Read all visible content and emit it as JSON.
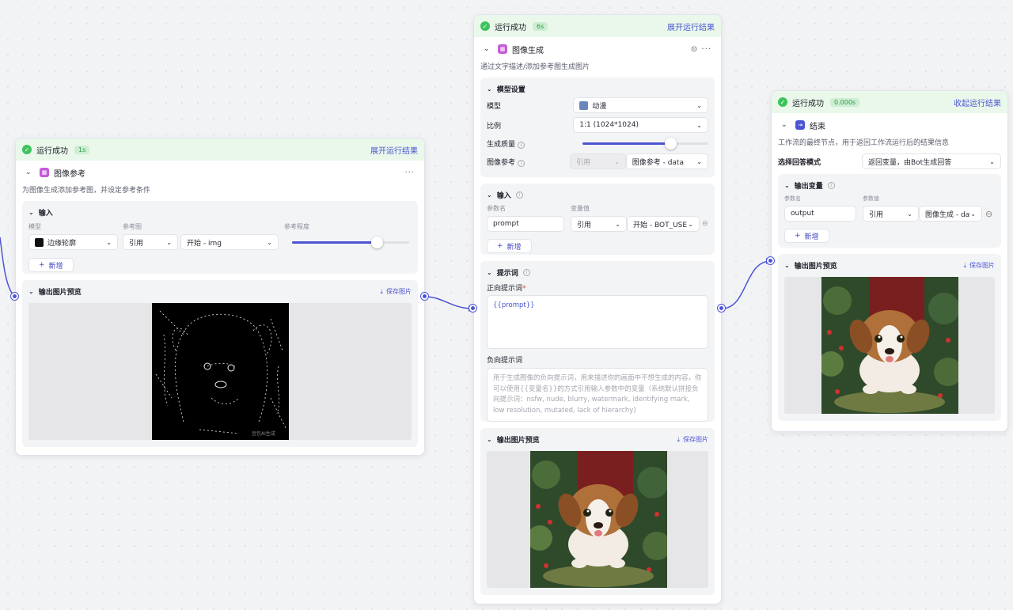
{
  "colors": {
    "accent": "#4c54d2",
    "success": "#3ec25d",
    "success_bg": "#e9f8ea",
    "canvas": "#f2f3f5"
  },
  "node_ref": {
    "status": "运行成功",
    "time": "1s",
    "toggle": "展开运行结果",
    "title": "图像参考",
    "desc": "为图像生成添加参考图，并设定参考条件",
    "input_title": "输入",
    "col_model": "模型",
    "col_ref": "参考图",
    "col_degree": "参考程度",
    "model_value": "边缘轮廓",
    "ref_type": "引用",
    "ref_value": "开始 - img",
    "degree": 0.72,
    "add_label": "新增",
    "preview_title": "输出图片预览",
    "save_label": "保存图片",
    "watermark": "豆包AI生成"
  },
  "node_gen": {
    "status": "运行成功",
    "time": "6s",
    "toggle": "展开运行结果",
    "title": "图像生成",
    "desc": "通过文字描述/添加参考图生成图片",
    "model_settings": "模型设置",
    "lbl_model": "模型",
    "model_value": "动漫",
    "lbl_ratio": "比例",
    "ratio_value": "1:1 (1024*1024)",
    "lbl_quality": "生成质量",
    "quality": 0.7,
    "lbl_imgref": "图像参考",
    "imgref_type": "引用",
    "imgref_value": "图像参考 - data",
    "input_title": "输入",
    "col_name": "参数名",
    "col_value": "变量值",
    "param_name": "prompt",
    "param_type": "引用",
    "param_value": "开始 - BOT_USE",
    "add_label": "新增",
    "prompt_title": "提示词",
    "positive_label": "正向提示词",
    "positive_value": "{{prompt}}",
    "negative_label": "负向提示词",
    "negative_placeholder": "用于生成图像的负向提示词，用来描述你的画面中不想生成的内容，你可以使用{{变量名}}的方式引用输入参数中的变量（系统默认拼接负向提示词：nsfw, nude, blurry, watermark, identifying mark, low resolution, mutated, lack of hierarchy)",
    "preview_title": "输出图片预览",
    "save_label": "保存图片"
  },
  "node_end": {
    "status": "运行成功",
    "time": "0.000s",
    "toggle": "收起运行结果",
    "title": "结束",
    "desc": "工作流的最终节点，用于返回工作流运行后的结果信息",
    "answer_mode_label": "选择回答模式",
    "answer_mode_value": "返回变量，由Bot生成回答",
    "output_title": "输出变量",
    "col_name": "参数名",
    "col_value": "参数值",
    "param_name": "output",
    "param_type": "引用",
    "param_value": "图像生成 - data",
    "add_label": "新增",
    "preview_title": "输出图片预览",
    "save_label": "保存图片"
  }
}
